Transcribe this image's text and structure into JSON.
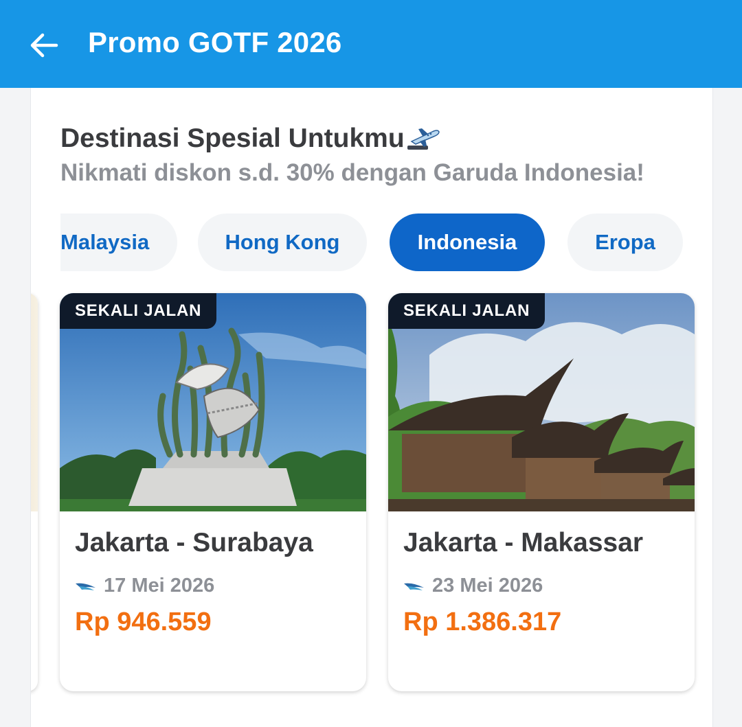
{
  "appbar": {
    "title": "Promo GOTF 2026",
    "color": "#1796e6"
  },
  "section": {
    "title": "Destinasi Spesial Untukmu",
    "subtitle": "Nikmati diskon s.d. 30% dengan Garuda Indonesia!"
  },
  "tabs": [
    {
      "label": "Malaysia",
      "active": false
    },
    {
      "label": "Hong Kong",
      "active": false
    },
    {
      "label": "Indonesia",
      "active": true
    },
    {
      "label": "Eropa",
      "active": false
    }
  ],
  "deals": [
    {
      "badge": "SEKALI JALAN",
      "route": "Jakarta - Surabaya",
      "date": "17 Mei 2026",
      "price": "Rp 946.559",
      "airline_icon": "garuda-icon"
    },
    {
      "badge": "SEKALI JALAN",
      "route": "Jakarta - Makassar",
      "date": "23 Mei 2026",
      "price": "Rp 1.386.317",
      "airline_icon": "garuda-icon"
    }
  ],
  "colors": {
    "accent": "#0e66c9",
    "price": "#f26f11",
    "badge": "#0f1a2a"
  }
}
